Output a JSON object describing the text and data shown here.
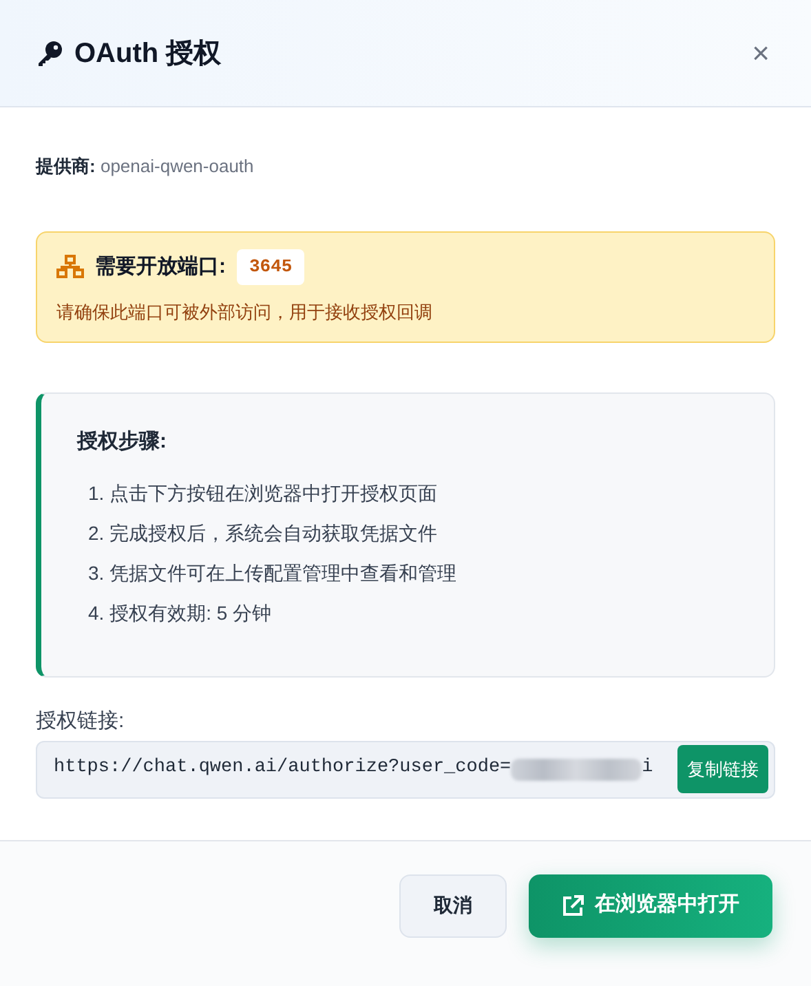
{
  "dialog": {
    "title": "OAuth 授权",
    "close": "×"
  },
  "provider": {
    "label": "提供商:",
    "value": "openai-qwen-oauth"
  },
  "port_notice": {
    "title": "需要开放端口:",
    "port": "3645",
    "text": "请确保此端口可被外部访问，用于接收授权回调"
  },
  "steps": {
    "title": "授权步骤:",
    "items": [
      {
        "number": "1.",
        "text": "点击下方按钮在浏览器中打开授权页面"
      },
      {
        "number": "2.",
        "text": "完成授权后，系统会自动获取凭据文件"
      },
      {
        "number": "3.",
        "text": "凭据文件可在上传配置管理中查看和管理"
      },
      {
        "number": "4.",
        "text": "授权有效期: 5 分钟"
      }
    ]
  },
  "link": {
    "label": "授权链接:",
    "value": "https://chat.qwen.ai/authorize?user_code=",
    "redacted": true,
    "tail": "i",
    "copy_button": "复制链接"
  },
  "buttons": [
    {
      "kind": "secondary",
      "label": "取消"
    },
    {
      "kind": "primary",
      "label": "在浏览器中打开"
    }
  ]
}
